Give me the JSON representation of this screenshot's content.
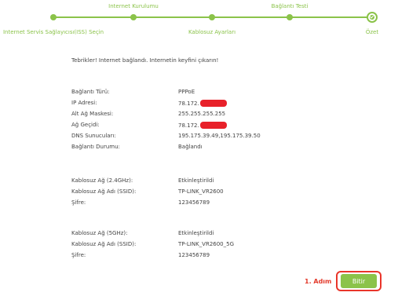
{
  "progress": {
    "top_labels": [
      "Internet Kurulumu",
      "Bağlantı Testi"
    ],
    "bottom_labels": [
      "Internet Servis Sağlayıcısı(ISS) Seçin",
      "Kablosuz Ayarları",
      "Özet"
    ],
    "accent_color": "#8bc34a",
    "current_step_icon": "check-icon"
  },
  "summary": {
    "congrats": "Tebrikler! Internet bağlandı. Internetin keyfini çıkarın!",
    "connection": [
      {
        "label": "Bağlantı Türü:",
        "value": "PPPoE"
      },
      {
        "label": "IP Adresi:",
        "value": "78.172.",
        "redacted": true
      },
      {
        "label": "Alt Ağ Maskesi:",
        "value": "255.255.255.255"
      },
      {
        "label": "Ağ Geçidi:",
        "value": "78.172.",
        "redacted": true
      },
      {
        "label": "DNS Sunucuları:",
        "value": "195.175.39.49,195.175.39.50"
      },
      {
        "label": "Bağlantı Durumu:",
        "value": "Bağlandı"
      }
    ],
    "wireless_24": [
      {
        "label": "Kablosuz Ağ (2.4GHz):",
        "value": "Etkinleştirildi"
      },
      {
        "label": "Kablosuz Ağ Adı (SSID):",
        "value": "TP-LINK_VR2600"
      },
      {
        "label": "Şifre:",
        "value": "123456789"
      }
    ],
    "wireless_5": [
      {
        "label": "Kablosuz Ağ (5GHz):",
        "value": "Etkinleştirildi"
      },
      {
        "label": "Kablosuz Ağ Adı (SSID):",
        "value": "TP-LINK_VR2600_5G"
      },
      {
        "label": "Şifre:",
        "value": "123456789"
      }
    ]
  },
  "footer": {
    "step_annotation": "1. Adım",
    "finish_label": "Bitir",
    "annotation_color": "#e33a2b"
  }
}
